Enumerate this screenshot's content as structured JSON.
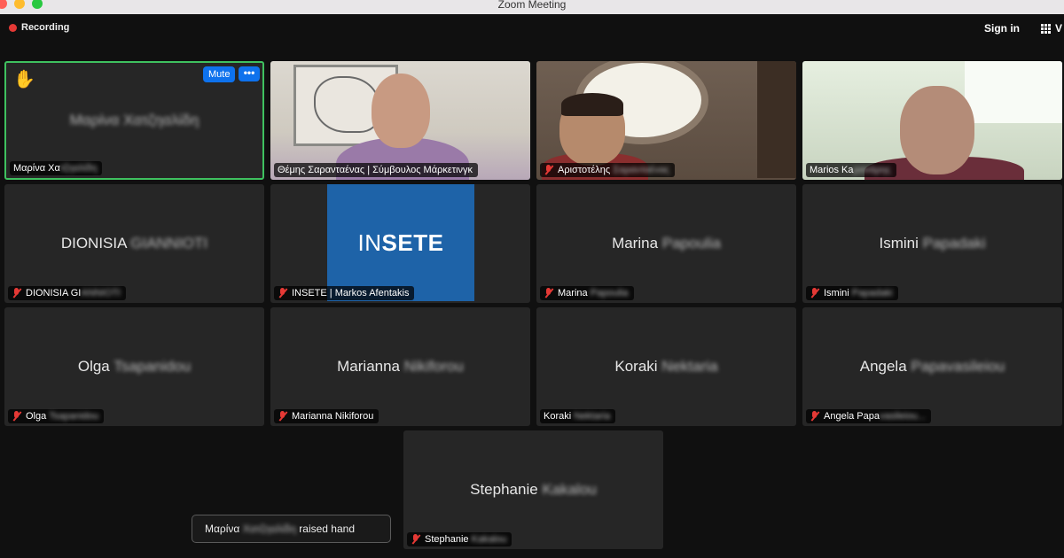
{
  "window": {
    "title": "Zoom Meeting"
  },
  "topbar": {
    "recording_label": "Recording",
    "signin_label": "Sign in",
    "view_label": "V"
  },
  "participants": [
    {
      "name_big": "Μαρίνα Χατζηαλίδη",
      "label_visible": "Μαρίνα Χα",
      "label_blurred": "τζηαλίδη",
      "active_speaker": true,
      "raised_hand": true,
      "mute_button": "Mute",
      "more_button": "•••"
    },
    {
      "label_visible": "Θέμης Σαρανταένας | Σύμβουλος Μάρκετινγκ",
      "video": true
    },
    {
      "label_visible": "Αριστοτέλης",
      "label_blurred": "Σαρανταένας",
      "video": true,
      "muted": true
    },
    {
      "label_visible": "Marios Ka",
      "label_blurred": "ρανάρης",
      "video": true
    },
    {
      "name_big_visible": "DIONISIA",
      "name_big_blurred": "GIANNIOTI",
      "label_visible": "DIONISIA GI",
      "label_blurred": "ANNIOTI",
      "muted": true
    },
    {
      "label_visible": "INSETE | Markos Afentakis",
      "logo_light": "IN",
      "logo_bold": "SETE",
      "muted": true
    },
    {
      "name_big_visible": "Marina",
      "name_big_blurred": "Papoulia",
      "label_visible": "Marina",
      "label_blurred": "Papoulia",
      "muted": true
    },
    {
      "name_big_visible": "Ismini",
      "name_big_blurred": "Papadaki",
      "label_visible": "Ismini",
      "label_blurred": "Papadaki",
      "muted": true
    },
    {
      "name_big_visible": "Olga",
      "name_big_blurred": "Tsapanidou",
      "label_visible": "Olga",
      "label_blurred": "Tsapanidou",
      "muted": true
    },
    {
      "name_big_visible": "Marianna",
      "name_big_blurred": "Nikiforou",
      "label_visible": "Marianna Nikiforou",
      "label_blurred": "",
      "muted": true
    },
    {
      "name_big_visible": "Koraki",
      "name_big_blurred": "Nektaria",
      "label_visible": "Koraki",
      "label_blurred": "Nektaria",
      "muted": false
    },
    {
      "name_big_visible": "Angela",
      "name_big_blurred": "Papavasileiou",
      "label_visible": "Angela Papa",
      "label_blurred": "vasileiou...",
      "muted": true
    },
    {
      "name_big_visible": "Stephanie",
      "name_big_blurred": "Kakalou",
      "label_visible": "Stephanie",
      "label_blurred": "Kakalou",
      "muted": true
    }
  ],
  "toast": {
    "name_visible": "Μαρίνα",
    "name_blurred": "Χατζηαλίδη",
    "message": "raised hand"
  },
  "colors": {
    "active_border": "#3fc15f",
    "accent_blue": "#0e72ed",
    "recording_red": "#e53935",
    "insete_blue": "#1e63a8"
  }
}
